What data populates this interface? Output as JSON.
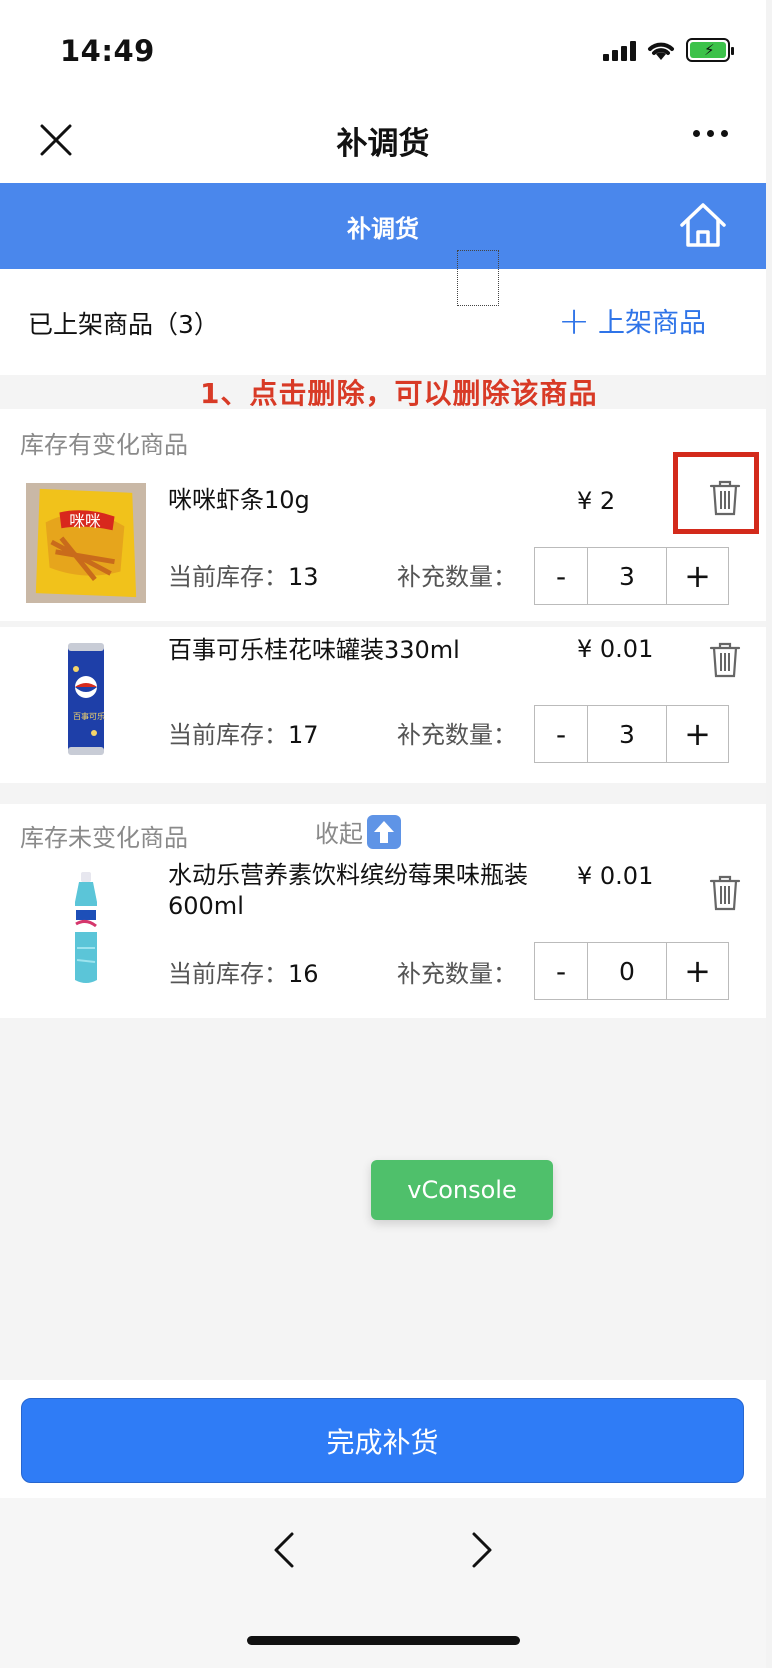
{
  "status": {
    "time": "14:49"
  },
  "nav": {
    "title": "补调货"
  },
  "header": {
    "title": "补调货"
  },
  "summary": {
    "label": "已上架商品（3）",
    "add_label": "上架商品"
  },
  "annotation": {
    "text": "1、点击删除，可以删除该商品",
    "color": "#d83a26"
  },
  "sections": {
    "changed": {
      "title": "库存有变化商品"
    },
    "unchanged": {
      "title": "库存未变化商品",
      "toggle": "收起"
    }
  },
  "labels": {
    "stock": "当前库存：",
    "qty": "补充数量：",
    "minus": "-",
    "plus": "+"
  },
  "items": [
    {
      "name": "咪咪虾条10g",
      "price": "¥ 2",
      "stock": "13",
      "qty": "3"
    },
    {
      "name": "百事可乐桂花味罐装330ml",
      "price": "¥ 0.01",
      "stock": "17",
      "qty": "3"
    },
    {
      "name": "水动乐营养素饮料缤纷莓果味瓶装600ml",
      "price": "¥ 0.01",
      "stock": "16",
      "qty": "0"
    }
  ],
  "vconsole": {
    "label": "vConsole"
  },
  "footer": {
    "complete_label": "完成补货"
  },
  "colors": {
    "accent": "#2f7cf6",
    "header_blue": "#4a87ec",
    "annotation_red": "#d32a1b",
    "vconsole_green": "#4fc06b"
  }
}
